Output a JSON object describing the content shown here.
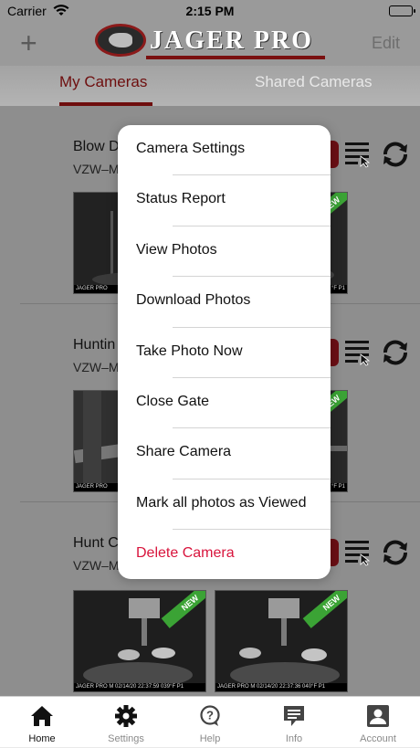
{
  "status_bar": {
    "carrier": "Carrier",
    "time": "2:15 PM"
  },
  "header": {
    "brand": "JAGER PRO",
    "edit_label": "Edit"
  },
  "tabs": {
    "my_cameras": "My Cameras",
    "shared_cameras": "Shared Cameras"
  },
  "cameras": [
    {
      "name": "Blow D",
      "sub": "VZW–M",
      "thumb_left": "JAGER PRO",
      "thumb_right": "°F P1",
      "ribbon": "NEW"
    },
    {
      "name": "Huntin",
      "sub": "VZW–M",
      "thumb_left": "JAGER PRO",
      "thumb_right": "°F P1",
      "ribbon": "NEW"
    },
    {
      "name": "Hunt C",
      "sub": "VZW–M",
      "thumb_left": "JAGER PRO   M   02/14/20 22:37:59   039°F P1",
      "thumb_right": "JAGER PRO   M   02/14/20 22:37:36   040°F P1",
      "ribbon": "NEW"
    }
  ],
  "menu": {
    "items": [
      "Camera Settings",
      "Status Report",
      "View Photos",
      "Download Photos",
      "Take Photo Now",
      "Close Gate",
      "Share Camera",
      "Mark all photos as Viewed",
      "Delete Camera"
    ]
  },
  "tabbar": {
    "items": [
      {
        "label": "Home",
        "icon": "home-icon"
      },
      {
        "label": "Settings",
        "icon": "gear-icon"
      },
      {
        "label": "Help",
        "icon": "help-icon"
      },
      {
        "label": "Info",
        "icon": "info-icon"
      },
      {
        "label": "Account",
        "icon": "account-icon"
      }
    ]
  },
  "colors": {
    "accent": "#6e0e0e",
    "danger": "#d8143c",
    "ribbon": "#3ba335"
  }
}
